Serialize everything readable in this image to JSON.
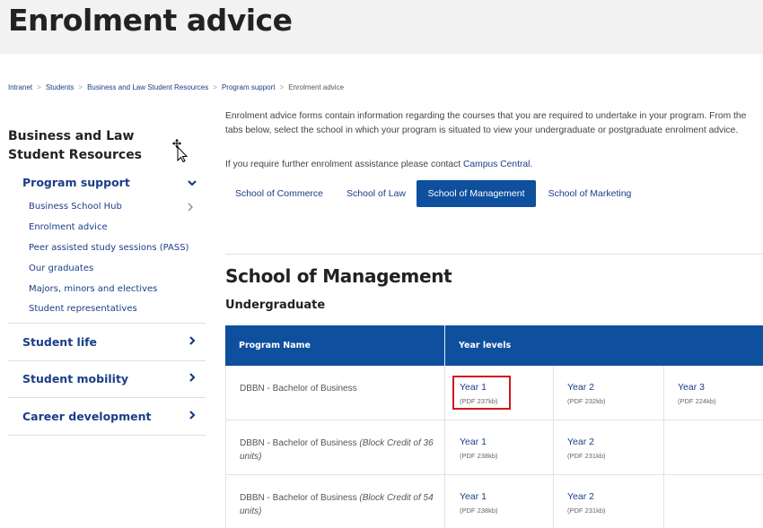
{
  "page": {
    "title": "Enrolment advice"
  },
  "breadcrumb": [
    {
      "label": "Intranet"
    },
    {
      "label": "Students"
    },
    {
      "label": "Business and Law Student Resources"
    },
    {
      "label": "Program support"
    },
    {
      "label": "Enrolment advice",
      "current": true
    }
  ],
  "sidebar": {
    "title": "Business and Law Student Resources",
    "sections": {
      "program_support": "Program support",
      "student_life": "Student life",
      "student_mobility": "Student mobility",
      "career_development": "Career development"
    },
    "items": [
      {
        "label": "Business School Hub"
      },
      {
        "label": "Enrolment advice"
      },
      {
        "label": "Peer assisted study sessions (PASS)"
      },
      {
        "label": "Our graduates"
      },
      {
        "label": "Majors, minors and electives"
      },
      {
        "label": "Student representatives"
      }
    ]
  },
  "main": {
    "intro": "Enrolment advice forms contain information regarding the courses that you are required to undertake in your program. From the tabs below, select the school in which your program is situated to view your undergraduate or postgraduate enrolment advice.",
    "assist_text": "If you require further enrolment assistance please contact ",
    "assist_link": "Campus Central",
    "assist_end": ".",
    "tabs": [
      {
        "label": "School of Commerce"
      },
      {
        "label": "School of Law"
      },
      {
        "label": "School of Management",
        "active": true
      },
      {
        "label": "School of Marketing"
      }
    ],
    "section_title": "School of Management",
    "subsection_title": "Undergraduate"
  },
  "table": {
    "headers": {
      "program": "Program Name",
      "years": "Year levels"
    },
    "rows": [
      {
        "program": "DBBN - Bachelor of Business",
        "program_note": "",
        "years": [
          {
            "label": "Year 1",
            "size": "(PDF 237kb)"
          },
          {
            "label": "Year 2",
            "size": "(PDF 232kb)"
          },
          {
            "label": "Year 3",
            "size": "(PDF 224kb)"
          }
        ]
      },
      {
        "program": "DBBN - Bachelor of Business ",
        "program_note": "(Block Credit of 36 units)",
        "years": [
          {
            "label": "Year 1",
            "size": "(PDF 238kb)"
          },
          {
            "label": "Year 2",
            "size": "(PDF 231kb)"
          }
        ]
      },
      {
        "program": "DBBN - Bachelor of Business ",
        "program_note": "(Block Credit of 54 units)",
        "years": [
          {
            "label": "Year 1",
            "size": "(PDF 238kb)"
          },
          {
            "label": "Year 2",
            "size": "(PDF 231kb)"
          }
        ]
      }
    ]
  },
  "colors": {
    "accent": "#0e4f9e",
    "link": "#1a3e87",
    "highlight": "#d0181f",
    "header_bg": "#f2f2f2"
  },
  "icons": {
    "chevron_down": "chevron-down-icon",
    "chevron_right": "chevron-right-icon",
    "cursor": "move-cursor-icon"
  }
}
